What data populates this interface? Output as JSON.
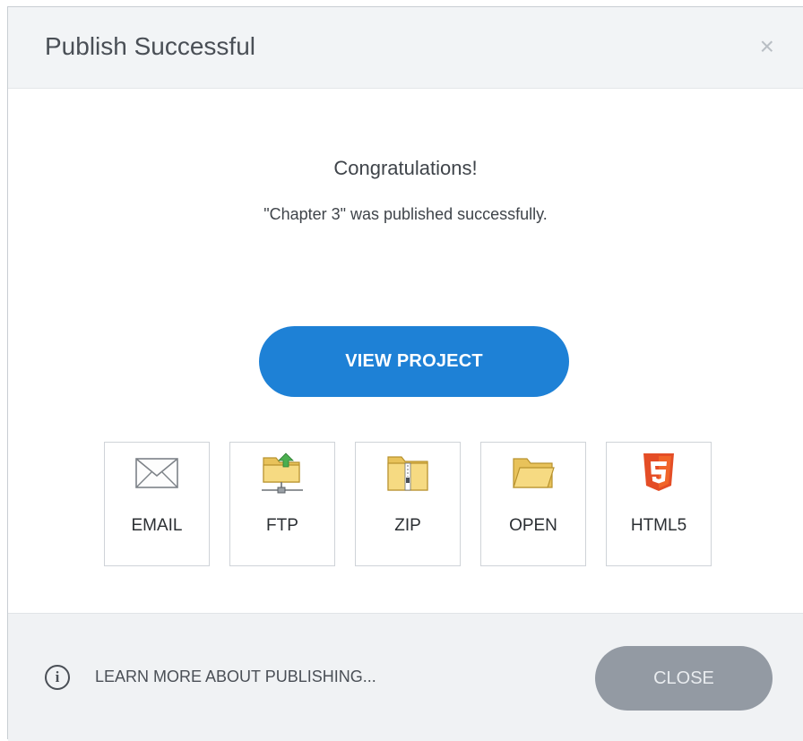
{
  "dialog": {
    "title": "Publish Successful",
    "close_glyph": "×"
  },
  "body": {
    "heading": "Congratulations!",
    "message": "\"Chapter 3\" was published successfully.",
    "view_button": "VIEW PROJECT"
  },
  "options": [
    {
      "label": "EMAIL",
      "icon": "envelope-icon"
    },
    {
      "label": "FTP",
      "icon": "ftp-folder-icon"
    },
    {
      "label": "ZIP",
      "icon": "zip-folder-icon"
    },
    {
      "label": "OPEN",
      "icon": "open-folder-icon"
    },
    {
      "label": "HTML5",
      "icon": "html5-icon"
    }
  ],
  "footer": {
    "info_glyph": "i",
    "learn_more": "LEARN MORE ABOUT PUBLISHING...",
    "close_button": "CLOSE"
  },
  "colors": {
    "primary_button": "#1e81d6",
    "close_button": "#939aa3",
    "html5_orange": "#e44d26",
    "folder_yellow": "#f5d77a"
  }
}
